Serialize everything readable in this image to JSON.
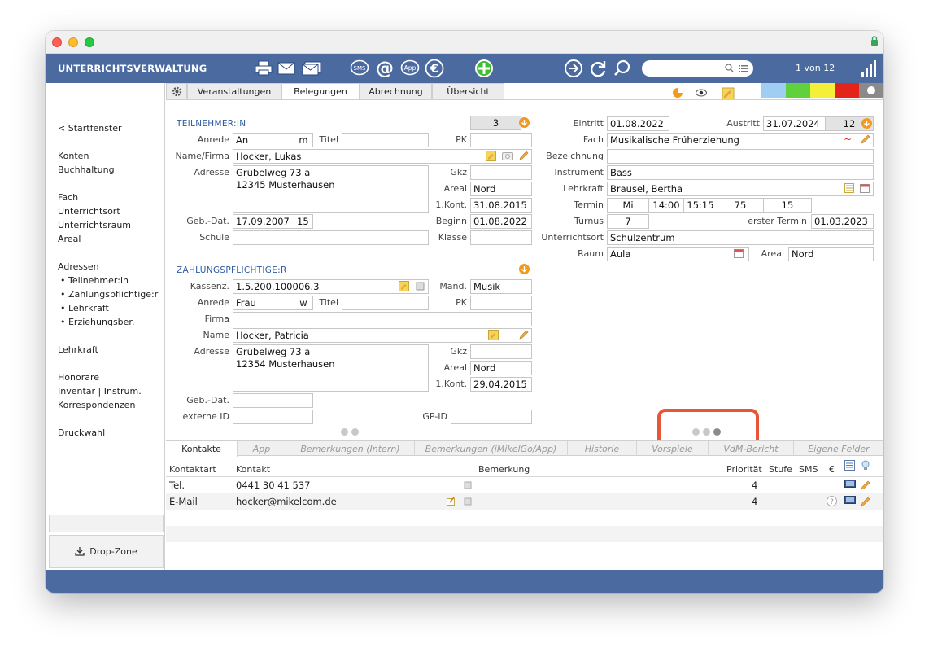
{
  "header": {
    "app_title": "UNTERRICHTSVERWALTUNG",
    "record_count": "1 von 12",
    "search_placeholder": ""
  },
  "toolbar_icons": [
    "printer-icon",
    "mail-icon",
    "mail-multiple-icon",
    "sms-icon",
    "email-at-icon",
    "app-icon",
    "euro-icon",
    "add-icon",
    "forward-icon",
    "refresh-icon",
    "search-icon",
    "signal-bars-icon"
  ],
  "sidebar": {
    "back": "< Startfenster",
    "items": [
      "Konten",
      "Buchhaltung",
      "Fach",
      "Unterrichtsort",
      "Unterrichtsraum",
      "Areal",
      "Adressen",
      "• Teilnehmer:in",
      "• Zahlungspflichtige:r",
      "• Lehrkraft",
      "• Erziehungsber.",
      "Lehrkraft",
      "Honorare",
      "Inventar | Instrum.",
      "Korrespondenzen",
      "Druckwahl"
    ],
    "drop_zone": "Drop-Zone"
  },
  "tabs": [
    "Veranstaltungen",
    "Belegungen",
    "Abrechnung",
    "Übersicht"
  ],
  "active_tab": "Belegungen",
  "color_bar": [
    "#9fcdf3",
    "#5fd13d",
    "#f4f03a",
    "#e4231a",
    "#8a8a8a"
  ],
  "teilnehmer": {
    "heading": "TEILNEHMER:IN",
    "count": "3",
    "labels": {
      "anrede": "Anrede",
      "titel": "Titel",
      "pk": "PK",
      "name": "Name/Firma",
      "adresse": "Adresse",
      "gkz": "Gkz",
      "areal": "Areal",
      "kont": "1.Kont.",
      "geb": "Geb.-Dat.",
      "beginn": "Beginn",
      "schule": "Schule",
      "klasse": "Klasse"
    },
    "anrede": "An",
    "anrede_short": "m",
    "titel": "",
    "pk": "",
    "name": "Hocker, Lukas",
    "adresse_line1": "Grübelweg 73 a",
    "adresse_line2": "12345 Musterhausen",
    "gkz": "",
    "areal": "Nord",
    "kont": "31.08.2015",
    "geb": "17.09.2007",
    "age": "15",
    "beginn": "01.08.2022",
    "schule": "",
    "klasse": ""
  },
  "zahler": {
    "heading": "ZAHLUNGSPFLICHTIGE:R",
    "labels": {
      "kassenz": "Kassenz.",
      "mand": "Mand.",
      "anrede": "Anrede",
      "titel": "Titel",
      "pk": "PK",
      "firma": "Firma",
      "name": "Name",
      "adresse": "Adresse",
      "gkz": "Gkz",
      "areal": "Areal",
      "kont": "1.Kont.",
      "geb": "Geb.-Dat.",
      "externe": "externe ID",
      "gpid": "GP-ID"
    },
    "kassenz": "1.5.200.100006.3",
    "mand": "Musik",
    "anrede": "Frau",
    "anrede_short": "w",
    "titel": "",
    "pk": "",
    "firma": "",
    "name": "Hocker, Patricia",
    "adresse_line1": "Grübelweg 73 a",
    "adresse_line2": "12354 Musterhausen",
    "gkz": "",
    "areal": "Nord",
    "kont": "29.04.2015",
    "geb": "",
    "geb2": "",
    "externe": "",
    "gpid": ""
  },
  "belegung": {
    "labels": {
      "eintritt": "Eintritt",
      "austritt": "Austritt",
      "fach": "Fach",
      "bezeichnung": "Bezeichnung",
      "instrument": "Instrument",
      "lehrkraft": "Lehrkraft",
      "termin": "Termin",
      "turnus": "Turnus",
      "erster_termin": "erster Termin",
      "unterrichtsort": "Unterrichtsort",
      "raum": "Raum",
      "areal": "Areal"
    },
    "eintritt": "01.08.2022",
    "austritt": "31.07.2024",
    "austritt_count": "12",
    "fach": "Musikalische Früherziehung",
    "fach_mark": "~",
    "bezeichnung": "",
    "instrument": "Bass",
    "lehrkraft": "Brausel, Bertha",
    "termin_tag": "Mi",
    "termin_von": "14:00",
    "termin_bis": "15:15",
    "termin_dauer": "75",
    "termin_anzahl": "15",
    "turnus": "7",
    "erster_termin": "01.03.2023",
    "unterrichtsort": "Schulzentrum",
    "raum": "Aula",
    "areal": "Nord"
  },
  "bottom_tabs": [
    "Kontakte",
    "App",
    "Bemerkungen (Intern)",
    "Bemerkungen (iMikelGo/App)",
    "Historie",
    "Vorspiele",
    "VdM-Bericht",
    "Eigene Felder"
  ],
  "contacts": {
    "headers": [
      "Kontaktart",
      "Kontakt",
      "Bemerkung",
      "Priorität",
      "Stufe",
      "SMS",
      "€"
    ],
    "rows": [
      {
        "art": "Tel.",
        "kontakt": "0441 30 41 537",
        "bemerkung": "",
        "prio": "4"
      },
      {
        "art": "E-Mail",
        "kontakt": "hocker@mikelcom.de",
        "bemerkung": "",
        "prio": "4"
      }
    ]
  }
}
